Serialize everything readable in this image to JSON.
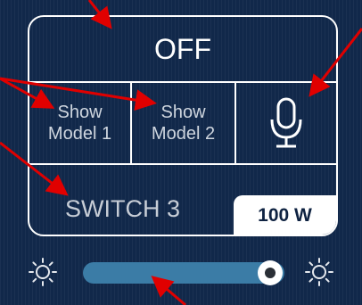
{
  "status": {
    "label": "OFF"
  },
  "buttons": [
    {
      "line1": "Show",
      "line2": "Model 1"
    },
    {
      "line1": "Show",
      "line2": "Model 2"
    }
  ],
  "mic": {
    "icon": "microphone-icon"
  },
  "switch": {
    "label": "SWITCH 3",
    "wattage": "100 W"
  },
  "brightness": {
    "level_percent": 93,
    "icon_low": "sun-icon",
    "icon_high": "sun-icon"
  },
  "colors": {
    "background": "#11284a",
    "outline": "#ffffff",
    "slider_track": "#3b7ca6",
    "annotation_arrow": "#e00000"
  }
}
